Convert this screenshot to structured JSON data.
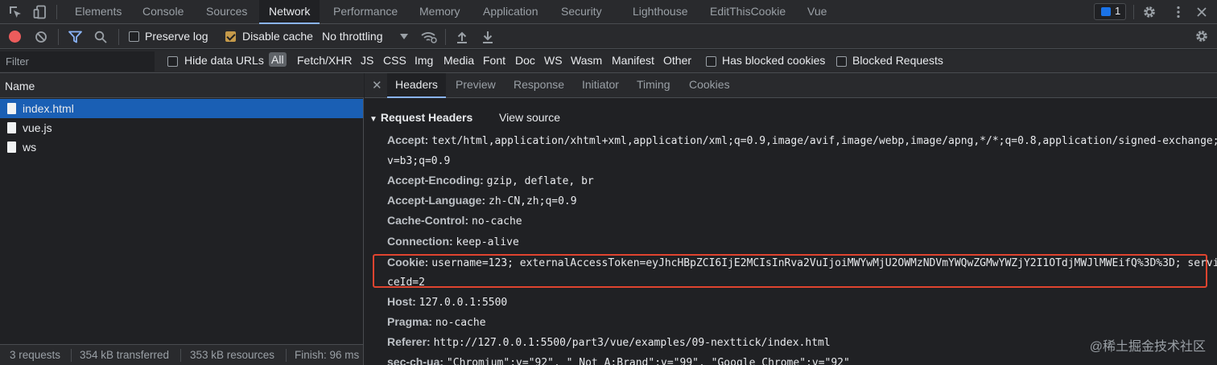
{
  "tabs": [
    "Elements",
    "Console",
    "Sources",
    "Network",
    "Performance",
    "Memory",
    "Application",
    "Security",
    "Lighthouse",
    "EditThisCookie",
    "Vue"
  ],
  "active_tab": "Network",
  "issues_count": "1",
  "toolbar": {
    "preserve_log": "Preserve log",
    "disable_cache": "Disable cache",
    "throttling": "No throttling"
  },
  "filter": {
    "placeholder": "Filter",
    "hide_data_urls": "Hide data URLs",
    "types": [
      "All",
      "Fetch/XHR",
      "JS",
      "CSS",
      "Img",
      "Media",
      "Font",
      "Doc",
      "WS",
      "Wasm",
      "Manifest",
      "Other"
    ],
    "has_blocked_cookies": "Has blocked cookies",
    "blocked_requests": "Blocked Requests"
  },
  "request_list": {
    "header": "Name",
    "items": [
      "index.html",
      "vue.js",
      "ws"
    ],
    "selected": "index.html"
  },
  "status": {
    "requests": "3 requests",
    "transferred": "354 kB transferred",
    "resources": "353 kB resources",
    "finish": "Finish: 96 ms"
  },
  "detail_tabs": [
    "Headers",
    "Preview",
    "Response",
    "Initiator",
    "Timing",
    "Cookies"
  ],
  "active_detail_tab": "Headers",
  "request_headers": {
    "title": "Request Headers",
    "view_source": "View source",
    "lines": [
      {
        "key": "Accept:",
        "value": "text/html,application/xhtml+xml,application/xml;q=0.9,image/avif,image/webp,image/apng,*/*;q=0.8,application/signed-exchange;"
      },
      {
        "key": "",
        "value": "v=b3;q=0.9"
      },
      {
        "key": "Accept-Encoding:",
        "value": "gzip, deflate, br"
      },
      {
        "key": "Accept-Language:",
        "value": "zh-CN,zh;q=0.9"
      },
      {
        "key": "Cache-Control:",
        "value": "no-cache"
      },
      {
        "key": "Connection:",
        "value": "keep-alive"
      },
      {
        "key": "Cookie:",
        "value": "username=123; externalAccessToken=eyJhcHBpZCI6IjE2MCIsInRva2VuIjoiMWYwMjU2OWMzNDVmYWQwZGMwYWZjY2I1OTdjMWJlMWEifQ%3D%3D; servi"
      },
      {
        "key": "",
        "value": "ceId=2"
      },
      {
        "key": "Host:",
        "value": "127.0.0.1:5500"
      },
      {
        "key": "Pragma:",
        "value": "no-cache"
      },
      {
        "key": "Referer:",
        "value": "http://127.0.0.1:5500/part3/vue/examples/09-nexttick/index.html"
      },
      {
        "key": "sec-ch-ua:",
        "value": "\"Chromium\";v=\"92\", \" Not A;Brand\";v=\"99\", \"Google Chrome\";v=\"92\""
      }
    ]
  },
  "watermark": "@稀土掘金技术社区",
  "colors": {
    "accent": "#8ab4f8",
    "selection": "#1a5fb4",
    "highlight_border": "#e0442f",
    "record": "#ec5c5c"
  }
}
